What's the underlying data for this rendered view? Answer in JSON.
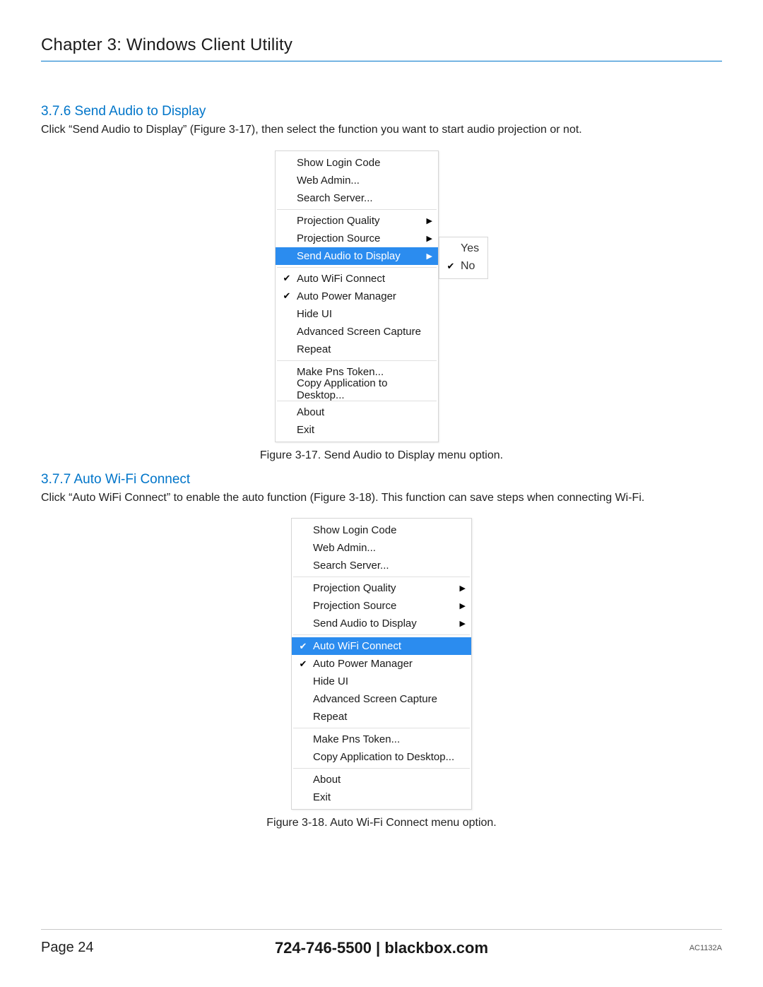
{
  "chapter": "Chapter 3: Windows Client Utility",
  "section376": {
    "heading": "3.7.6 Send Audio to Display",
    "body": "Click “Send Audio to Display” (Figure 3-17), then select the function you want to start audio projection or not.",
    "caption": "Figure 3-17. Send Audio to Display menu option."
  },
  "section377": {
    "heading": "3.7.7 Auto Wi-Fi Connect",
    "body": "Click “Auto WiFi Connect” to enable the auto function (Figure 3-18). This function can save steps when connecting Wi-Fi.",
    "caption": "Figure 3-18. Auto Wi-Fi Connect menu option."
  },
  "menu": {
    "show_login": "Show Login Code",
    "web_admin": "Web Admin...",
    "search_server": "Search Server...",
    "proj_quality": "Projection Quality",
    "proj_source": "Projection Source",
    "send_audio": "Send Audio to Display",
    "auto_wifi": "Auto WiFi Connect",
    "auto_power": "Auto Power Manager",
    "hide_ui": "Hide UI",
    "adv_capture": "Advanced Screen Capture",
    "repeat": "Repeat",
    "make_token": "Make Pns Token...",
    "copy_app": "Copy Application to Desktop...",
    "about": "About",
    "exit": "Exit"
  },
  "submenu": {
    "yes": "Yes",
    "no": "No"
  },
  "icons": {
    "check": "✔",
    "arrow": "▶"
  },
  "footer": {
    "page": "Page 24",
    "center": "724-746-5500   |   blackbox.com",
    "sku": "AC1132A"
  }
}
